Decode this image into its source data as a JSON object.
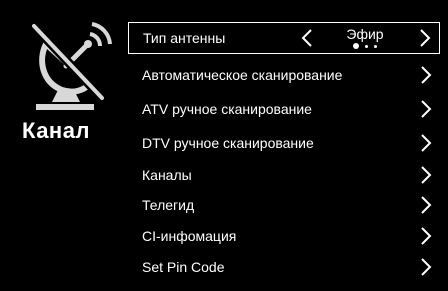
{
  "side": {
    "title": "Канал",
    "icon": "satellite-dish-crossed-icon"
  },
  "menu": {
    "antenna": {
      "label": "Тип антенны",
      "value": "Эфир",
      "options_count": 3,
      "selected_index": 0
    },
    "items": [
      {
        "label": "Автоматическое сканирование"
      },
      {
        "label": "ATV ручное сканирование"
      },
      {
        "label": "DTV ручное сканирование"
      },
      {
        "label": "Каналы"
      },
      {
        "label": "Телегид"
      },
      {
        "label": "CI-инфомация"
      },
      {
        "label": "Set Pin Code"
      }
    ]
  },
  "colors": {
    "background": "#000000",
    "foreground": "#ffffff"
  }
}
